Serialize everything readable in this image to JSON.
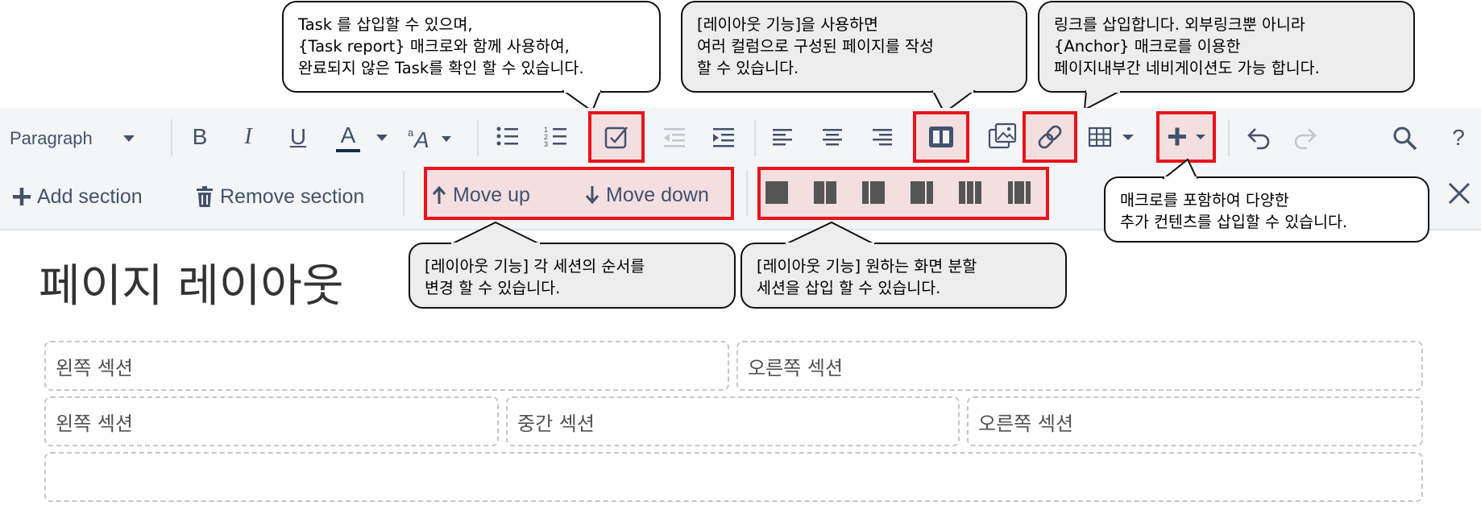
{
  "toolbar": {
    "paragraph_label": "Paragraph",
    "bold": "B",
    "italic": "I",
    "underline": "U",
    "text_color": "A",
    "help": "?"
  },
  "layout_toolbar": {
    "add_section": "Add section",
    "remove_section": "Remove section",
    "move_up": "Move up",
    "move_down": "Move down"
  },
  "callouts": {
    "task": "Task 를 삽입할 수 있으며,\n{Task report} 매크로와 함께 사용하여,\n완료되지 않은 Task를 확인 할 수 있습니다.",
    "layout": "[레이아웃 기능]을 사용하면\n여러 컬럼으로 구성된 페이지를 작성\n할 수 있습니다.",
    "link": "링크를 삽입합니다. 외부링크뿐 아니라\n{Anchor} 매크로를 이용한\n페이지내부간 네비게이션도 가능 합니다.",
    "macro": "매크로를 포함하여 다양한\n추가 컨텐츠를 삽입할 수 있습니다.",
    "move": "[레이아웃 기능] 각 세션의 순서를\n변경 할 수 있습니다.",
    "sections": "[레이아웃 기능] 원하는 화면 분할\n세션을 삽입 할 수 있습니다."
  },
  "page": {
    "title": "페이지 레이아웃",
    "row1": [
      "왼쪽 섹션",
      "오른쪽 섹션"
    ],
    "row2": [
      "왼쪽 섹션",
      "중간 섹션",
      "오른쪽 섹션"
    ]
  },
  "colors": {
    "highlight": "#e8141c",
    "toolbar_bg": "#f4f5f7",
    "icon": "#42526e"
  }
}
